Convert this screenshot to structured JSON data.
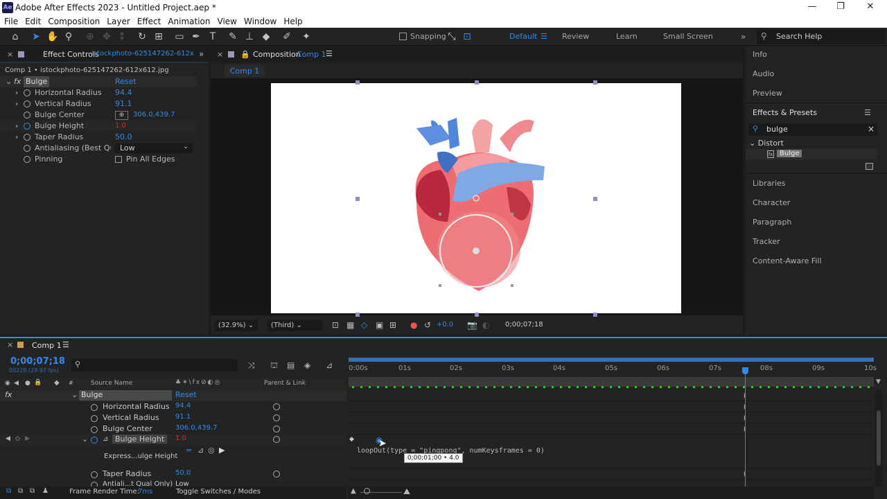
{
  "window": {
    "title": "Adobe After Effects 2023 - Untitled Project.aep *",
    "app_badge": "Ae",
    "controls": [
      "—",
      "❐",
      "✕"
    ]
  },
  "menu": [
    "File",
    "Edit",
    "Composition",
    "Layer",
    "Effect",
    "Animation",
    "View",
    "Window",
    "Help"
  ],
  "toolbar": {
    "snapping": "Snapping",
    "workspaces": [
      "Default",
      "Review",
      "Learn",
      "Small Screen"
    ],
    "search": "Search Help"
  },
  "effect_controls": {
    "tab": "Effect Controls",
    "layer": "istockphoto-625147262-612x",
    "subtitle": "Comp 1 • istockphoto-625147262-612x612.jpg",
    "effect": "Bulge",
    "reset": "Reset",
    "props": [
      {
        "name": "Horizontal Radius",
        "value": "94.4"
      },
      {
        "name": "Vertical Radius",
        "value": "91.1"
      },
      {
        "name": "Bulge Center",
        "value": "306.0,439.7"
      },
      {
        "name": "Bulge Height",
        "value": "1.0"
      },
      {
        "name": "Taper Radius",
        "value": "50.0"
      },
      {
        "name": "Antialiasing (Best Qual",
        "value": "Low"
      },
      {
        "name": "Pinning",
        "value": "Pin All Edges"
      }
    ]
  },
  "composition": {
    "tab": "Composition",
    "name": "Comp 1",
    "viewer_tab": "Comp 1",
    "zoom": "(32.9%)",
    "resolution": "(Third)",
    "exposure": "+0.0",
    "timecode": "0;00;07;18"
  },
  "right_panels": {
    "items": [
      "Info",
      "Audio",
      "Preview"
    ],
    "effects_presets": "Effects & Presets",
    "search": "bulge",
    "category": "Distort",
    "result": "Bulge",
    "more": [
      "Libraries",
      "Character",
      "Paragraph",
      "Tracker",
      "Content-Aware Fill"
    ]
  },
  "timeline": {
    "tab": "Comp 1",
    "timecode": "0;00;07;18",
    "frames": "00228 (29.97 fps)",
    "col_source": "Source Name",
    "col_parent": "Parent & Link",
    "effect": "Bulge",
    "reset": "Reset",
    "props": [
      {
        "name": "Horizontal Radius",
        "value": "94.4"
      },
      {
        "name": "Vertical Radius",
        "value": "91.1"
      },
      {
        "name": "Bulge Center",
        "value": "306.0,439.7"
      },
      {
        "name": "Bulge Height",
        "value": "1.0"
      },
      {
        "name": "Express...ulge Height",
        "value": ""
      },
      {
        "name": "Taper Radius",
        "value": "50.0"
      },
      {
        "name": "Antiali...t Qual Only)",
        "value": "Low"
      }
    ],
    "ruler": [
      "0:00s",
      "01s",
      "02s",
      "03s",
      "04s",
      "05s",
      "06s",
      "07s",
      "08s",
      "09s",
      "10s"
    ],
    "expression": "loopOut(type = \"pingpong\", numKeysframes = 0)",
    "tooltip": "0;00;01;00 • 4.0",
    "render_label": "Frame Render Time:",
    "render_value": "7ms",
    "toggle": "Toggle Switches / Modes"
  }
}
